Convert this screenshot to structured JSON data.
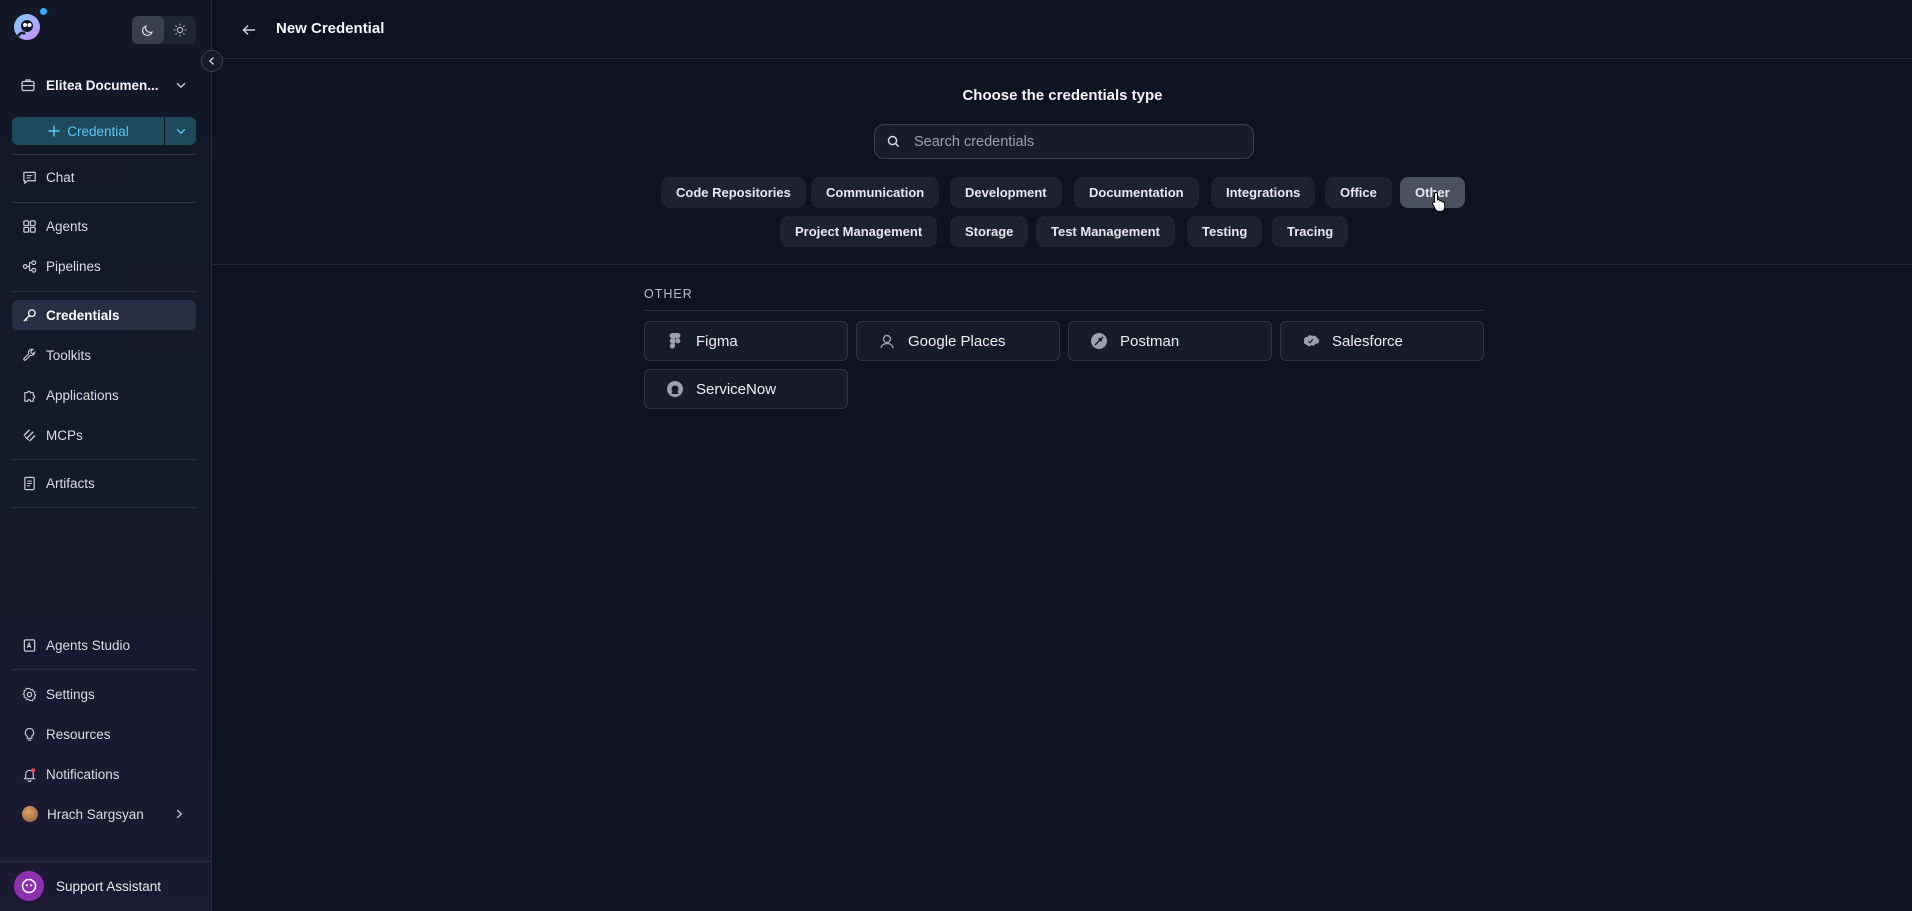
{
  "sidebar": {
    "project_name": "Elitea Documen...",
    "create_button_label": "Credential",
    "nav": {
      "chat": "Chat",
      "agents": "Agents",
      "pipelines": "Pipelines",
      "credentials": "Credentials",
      "toolkits": "Toolkits",
      "applications": "Applications",
      "mcps": "MCPs",
      "artifacts": "Artifacts",
      "agents_studio": "Agents Studio",
      "settings": "Settings",
      "resources": "Resources",
      "notifications": "Notifications"
    },
    "user_name": "Hrach Sargsyan",
    "support_label": "Support Assistant",
    "active_item": "credentials"
  },
  "header": {
    "title": "New Credential"
  },
  "main": {
    "choose_title": "Choose the credentials type",
    "search_placeholder": "Search credentials",
    "categories": [
      "Code Repositories",
      "Communication",
      "Development",
      "Documentation",
      "Integrations",
      "Office",
      "Other",
      "Project Management",
      "Storage",
      "Test Management",
      "Testing",
      "Tracing"
    ],
    "active_category": "Other",
    "section_label": "OTHER",
    "credentials": [
      {
        "label": "Figma",
        "icon": "figma-icon"
      },
      {
        "label": "Google Places",
        "icon": "google-places-icon"
      },
      {
        "label": "Postman",
        "icon": "postman-icon"
      },
      {
        "label": "Salesforce",
        "icon": "salesforce-icon"
      },
      {
        "label": "ServiceNow",
        "icon": "servicenow-icon"
      }
    ]
  },
  "colors": {
    "background": "#0e1321",
    "accent": "#5cc8f5",
    "active_chip": "#4a5161"
  }
}
